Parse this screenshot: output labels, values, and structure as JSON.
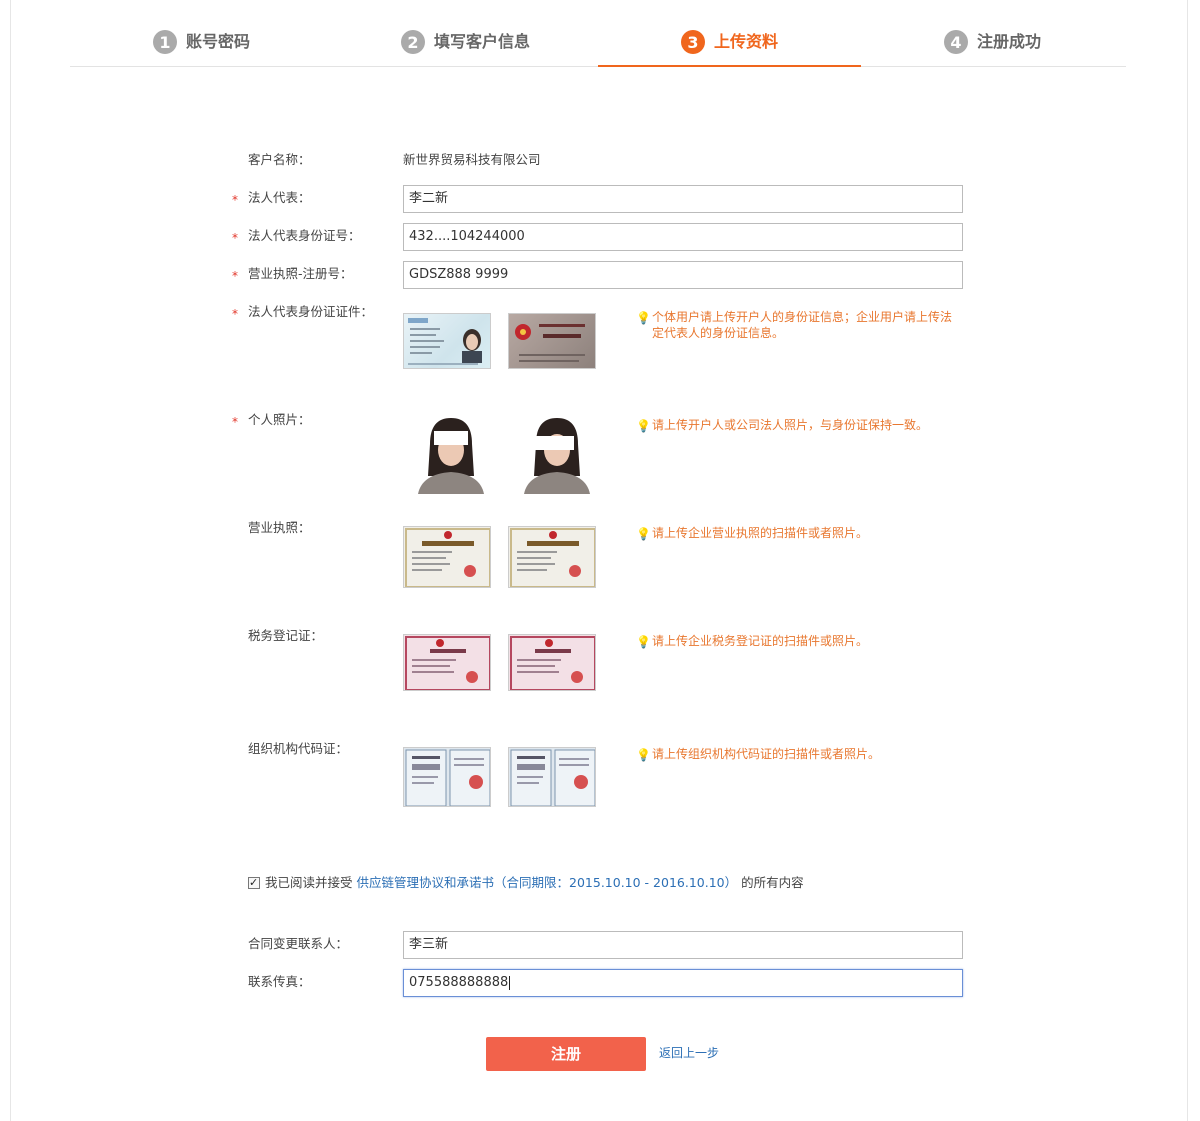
{
  "steps": [
    {
      "num": "1",
      "label": "账号密码"
    },
    {
      "num": "2",
      "label": "填写客户信息"
    },
    {
      "num": "3",
      "label": "上传资料"
    },
    {
      "num": "4",
      "label": "注册成功"
    }
  ],
  "active_step": 3,
  "form": {
    "customer_name_label": "客户名称：",
    "customer_name_value": "新世界贸易科技有限公司",
    "legal_rep_label": "法人代表：",
    "legal_rep_value": "李二新",
    "legal_rep_id_label": "法人代表身份证号：",
    "legal_rep_id_value": "432....104244000",
    "license_no_label": "营业执照-注册号：",
    "license_no_value": "GDSZ888 9999",
    "id_docs_label": "法人代表身份证证件：",
    "id_docs_tip": "个体用户请上传开户人的身份证信息；企业用户请上传法定代表人的身份证信息。",
    "photo_label": "个人照片：",
    "photo_tip": "请上传开户人或公司法人照片，与身份证保持一致。",
    "business_license_label": "营业执照：",
    "business_license_tip": "请上传企业营业执照的扫描件或者照片。",
    "tax_label": "税务登记证：",
    "tax_tip": "请上传企业税务登记证的扫描件或照片。",
    "org_code_label": "组织机构代码证：",
    "org_code_tip": "请上传组织机构代码证的扫描件或者照片。",
    "required_mark": "*"
  },
  "agreement": {
    "prefix": "我已阅读并接受",
    "link": "供应链管理协议和承诺书（合同期限：2015.10.10 - 2016.10.10）",
    "suffix": "的所有内容",
    "checked": true
  },
  "contact": {
    "contact_label": "合同变更联系人：",
    "contact_value": "李三新",
    "fax_label": "联系传真：",
    "fax_value": "075588888888"
  },
  "actions": {
    "submit": "注册",
    "back": "返回上一步"
  },
  "colors": {
    "accent": "#f0661d",
    "button": "#f2624b",
    "link": "#2c6fb5",
    "tip": "#e8772f",
    "required": "#e2362a"
  }
}
